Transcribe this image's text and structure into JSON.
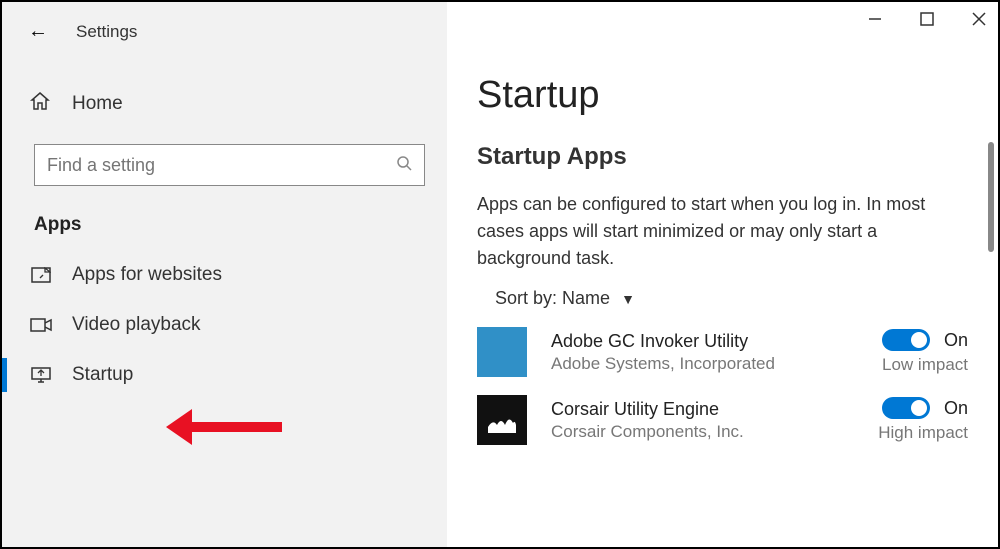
{
  "window": {
    "title": "Settings"
  },
  "sidebar": {
    "home_label": "Home",
    "search_placeholder": "Find a setting",
    "category_label": "Apps",
    "items": [
      {
        "label": "Apps for websites"
      },
      {
        "label": "Video playback"
      },
      {
        "label": "Startup"
      }
    ]
  },
  "main": {
    "page_title": "Startup",
    "section_title": "Startup Apps",
    "description": "Apps can be configured to start when you log in. In most cases apps will start minimized or may only start a background task.",
    "sort_prefix": "Sort by: ",
    "sort_value": "Name",
    "apps": [
      {
        "name": "Adobe GC Invoker Utility",
        "publisher": "Adobe Systems, Incorporated",
        "toggle_state": "On",
        "impact": "Low impact"
      },
      {
        "name": "Corsair Utility Engine",
        "publisher": "Corsair Components, Inc.",
        "toggle_state": "On",
        "impact": "High impact"
      }
    ]
  }
}
